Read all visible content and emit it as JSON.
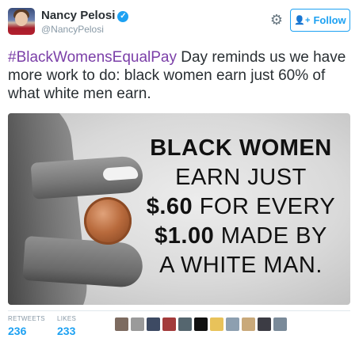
{
  "author": {
    "display_name": "Nancy Pelosi",
    "verified": "✓",
    "handle": "@NancyPelosi"
  },
  "actions": {
    "follow_label": "Follow",
    "follow_icon": "add-user-icon",
    "settings_icon": "gear-icon"
  },
  "tweet": {
    "hashtag": "#BlackWomensEqualPay",
    "text": " Day reminds us we have more work to do: black women earn just 60% of what white men earn."
  },
  "image": {
    "lines": [
      {
        "bold": "BLACK WOMEN",
        "rest": ""
      },
      {
        "bold": "",
        "rest": "EARN JUST"
      },
      {
        "bold": "$.60",
        "rest": " FOR EVERY"
      },
      {
        "bold": "$1.00",
        "rest": " MADE BY"
      },
      {
        "bold": "",
        "rest": "A WHITE MAN."
      }
    ]
  },
  "stats": {
    "retweets_label": "RETWEETS",
    "retweets_value": "236",
    "likes_label": "LIKES",
    "likes_value": "233"
  },
  "likers": [
    {
      "color": "#7d6b60"
    },
    {
      "color": "#9a9a9a"
    },
    {
      "color": "#3d4a63"
    },
    {
      "color": "#a33b3b"
    },
    {
      "color": "#55666f"
    },
    {
      "color": "#111111"
    },
    {
      "color": "#e8c25a"
    },
    {
      "color": "#8d9fb0"
    },
    {
      "color": "#c9a97a"
    },
    {
      "color": "#3c3c44"
    },
    {
      "color": "#7a8a99"
    }
  ],
  "colors": {
    "accent": "#1da1f2",
    "hashtag": "#7b3fa8",
    "text": "#292f33",
    "muted": "#8899a6"
  }
}
